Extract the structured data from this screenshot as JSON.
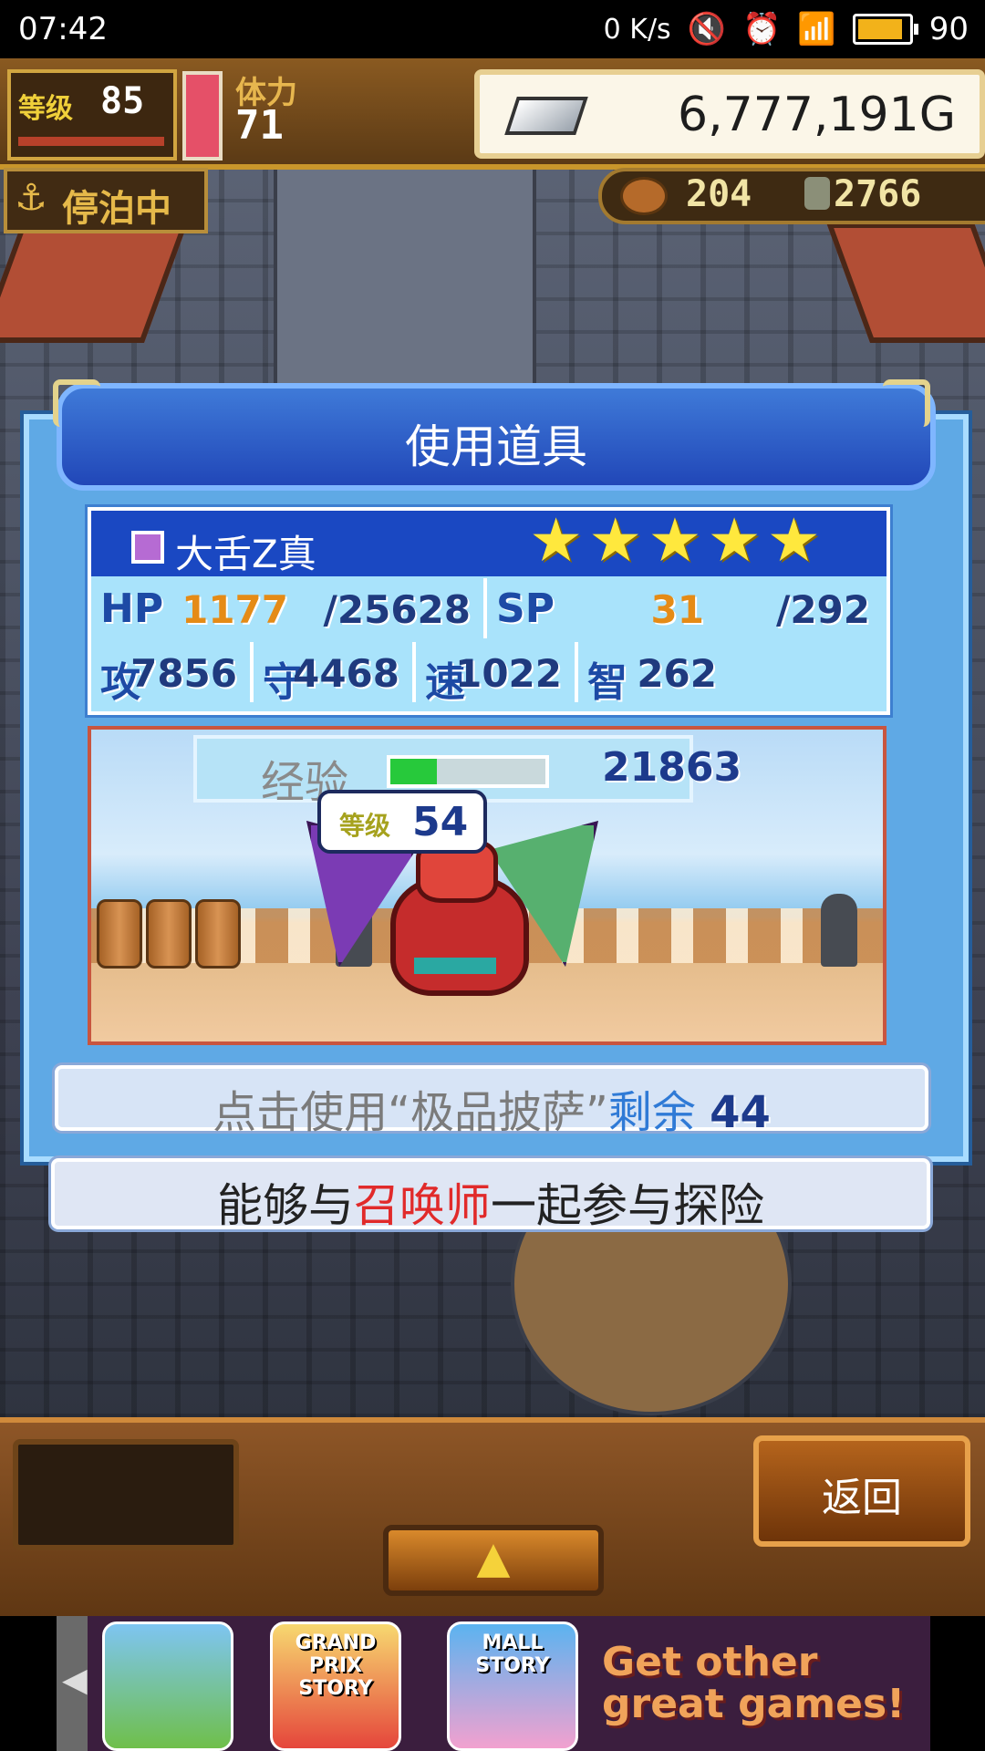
{
  "status_bar": {
    "time": "07:42",
    "net_speed": "0 K/s",
    "battery": "90"
  },
  "hud": {
    "level_label": "等级",
    "level": "85",
    "stamina_label": "体力",
    "stamina": "71",
    "money": "6,777,191G",
    "dock_status": "停泊中",
    "food": "204",
    "medals": "2766"
  },
  "dialog": {
    "title": "使用道具",
    "monster": {
      "name": "大舌Z真",
      "stars": 5,
      "hp_label": "HP",
      "hp_current": "1177",
      "hp_max": "/25628",
      "sp_label": "SP",
      "sp_current": "31",
      "sp_max": "/292",
      "atk_label": "攻",
      "atk": "7856",
      "def_label": "守",
      "def": "4468",
      "spd_label": "速",
      "spd": "1022",
      "int_label": "智",
      "int": "262",
      "exp_label": "经验",
      "exp": "21863",
      "exp_progress": 0.3,
      "level_label": "等级",
      "level": "54"
    },
    "use_prefix": "点击使用“极品披萨”",
    "use_remaining_label": "剩余",
    "use_count": "44",
    "desc_part1": "能够与",
    "desc_highlight": "召唤师",
    "desc_part2": "一起参与探险"
  },
  "bottom": {
    "back_label": "返回",
    "up_glyph": "▲"
  },
  "ad": {
    "left_arrow": "◀",
    "game1": "",
    "game2": "GRAND PRIX STORY",
    "game3": "MALL STORY",
    "tagline": "Get other great games!"
  }
}
